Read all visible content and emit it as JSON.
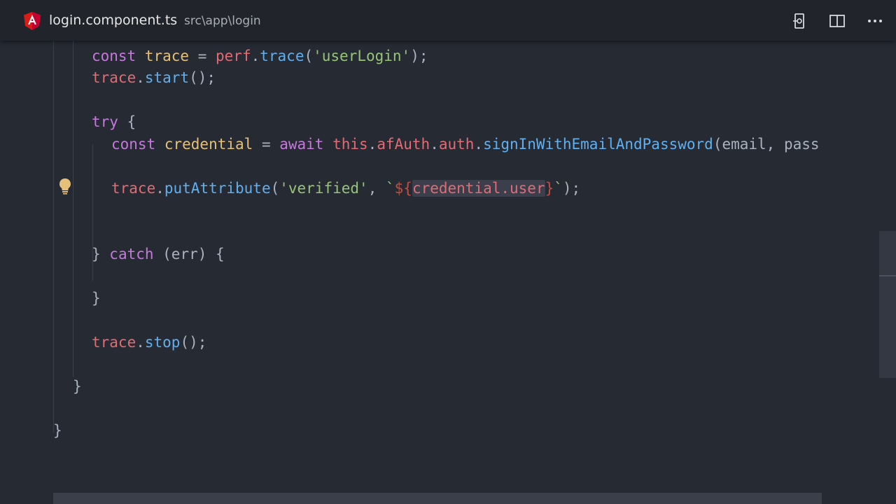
{
  "tab": {
    "filename": "login.component.ts",
    "path": "src\\app\\login",
    "icon": "angular-icon"
  },
  "toolbar": {
    "buttons": [
      "remote-icon",
      "split-editor-icon",
      "more-icon"
    ]
  },
  "code": {
    "lines": [
      {
        "tokens": [
          {
            "t": "const ",
            "c": "kw"
          },
          {
            "t": "trace",
            "c": "kwc"
          },
          {
            "t": " = ",
            "c": "plain"
          },
          {
            "t": "perf",
            "c": "var"
          },
          {
            "t": ".",
            "c": "plain"
          },
          {
            "t": "trace",
            "c": "fn"
          },
          {
            "t": "(",
            "c": "plain"
          },
          {
            "t": "'userLogin'",
            "c": "str"
          },
          {
            "t": ");",
            "c": "plain"
          }
        ]
      },
      {
        "tokens": [
          {
            "t": "trace",
            "c": "var"
          },
          {
            "t": ".",
            "c": "plain"
          },
          {
            "t": "start",
            "c": "fn"
          },
          {
            "t": "();",
            "c": "plain"
          }
        ]
      },
      {
        "tokens": []
      },
      {
        "tokens": [
          {
            "t": "try",
            "c": "kw"
          },
          {
            "t": " {",
            "c": "plain"
          }
        ]
      },
      {
        "tokens": [
          {
            "t": "const ",
            "c": "kw"
          },
          {
            "t": "credential",
            "c": "kwc"
          },
          {
            "t": " = ",
            "c": "plain"
          },
          {
            "t": "await ",
            "c": "kw"
          },
          {
            "t": "this",
            "c": "var"
          },
          {
            "t": ".",
            "c": "plain"
          },
          {
            "t": "afAuth",
            "c": "var"
          },
          {
            "t": ".",
            "c": "plain"
          },
          {
            "t": "auth",
            "c": "var"
          },
          {
            "t": ".",
            "c": "plain"
          },
          {
            "t": "signInWithEmailAndPassword",
            "c": "fn"
          },
          {
            "t": "(email, pass",
            "c": "plain"
          }
        ]
      },
      {
        "tokens": []
      },
      {
        "tokens": [
          {
            "t": "trace",
            "c": "var"
          },
          {
            "t": ".",
            "c": "plain"
          },
          {
            "t": "putAttribute",
            "c": "fn"
          },
          {
            "t": "(",
            "c": "plain"
          },
          {
            "t": "'verified'",
            "c": "str"
          },
          {
            "t": ", ",
            "c": "plain"
          },
          {
            "t": "`",
            "c": "str"
          },
          {
            "t": "${",
            "c": "tplc"
          },
          {
            "t": "credential.user",
            "c": "var",
            "sel": true
          },
          {
            "t": "}",
            "c": "tplc"
          },
          {
            "t": "`",
            "c": "str"
          },
          {
            "t": ");",
            "c": "plain"
          }
        ]
      },
      {
        "tokens": []
      },
      {
        "tokens": []
      },
      {
        "tokens": [
          {
            "t": "} ",
            "c": "plain"
          },
          {
            "t": "catch",
            "c": "kw"
          },
          {
            "t": " (err) {",
            "c": "plain"
          }
        ]
      },
      {
        "tokens": []
      },
      {
        "tokens": [
          {
            "t": "}",
            "c": "plain"
          }
        ]
      },
      {
        "tokens": []
      },
      {
        "tokens": [
          {
            "t": "trace",
            "c": "var"
          },
          {
            "t": ".",
            "c": "plain"
          },
          {
            "t": "stop",
            "c": "fn"
          },
          {
            "t": "();",
            "c": "plain"
          }
        ]
      },
      {
        "tokens": []
      },
      {
        "tokens": [
          {
            "t": "}",
            "c": "plain"
          }
        ]
      },
      {
        "tokens": []
      },
      {
        "tokens": [
          {
            "t": "}",
            "c": "plain"
          }
        ]
      }
    ]
  },
  "colors": {
    "keyword": "#c678dd",
    "variable": "#e06c75",
    "function": "#61afef",
    "string": "#98c379",
    "background": "#262a33"
  }
}
